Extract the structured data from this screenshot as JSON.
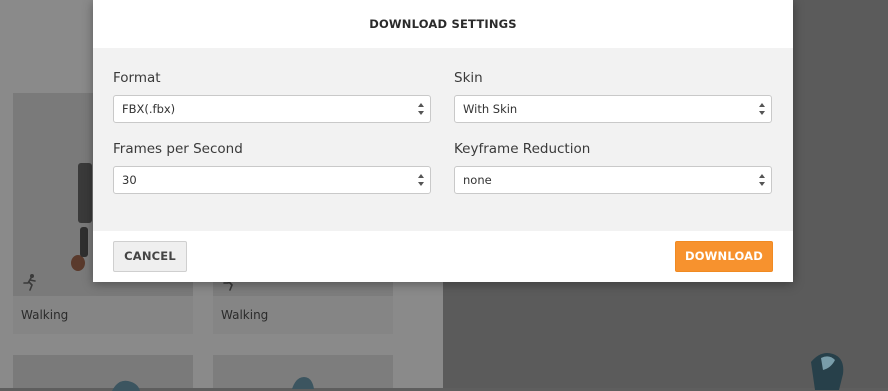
{
  "modal": {
    "title": "DOWNLOAD SETTINGS",
    "fields": [
      {
        "label": "Format",
        "value": "FBX(.fbx)"
      },
      {
        "label": "Skin",
        "value": "With Skin"
      },
      {
        "label": "Frames per Second",
        "value": "30"
      },
      {
        "label": "Keyframe Reduction",
        "value": "none"
      }
    ],
    "cancel_label": "CANCEL",
    "download_label": "DOWNLOAD"
  },
  "background": {
    "cards": [
      {
        "caption": "Walking"
      },
      {
        "caption": "Walking"
      }
    ]
  },
  "colors": {
    "accent": "#f7922e",
    "overlay": "#5e5e5e"
  },
  "icons": [
    "runner-icon",
    "select-arrows-icon"
  ]
}
